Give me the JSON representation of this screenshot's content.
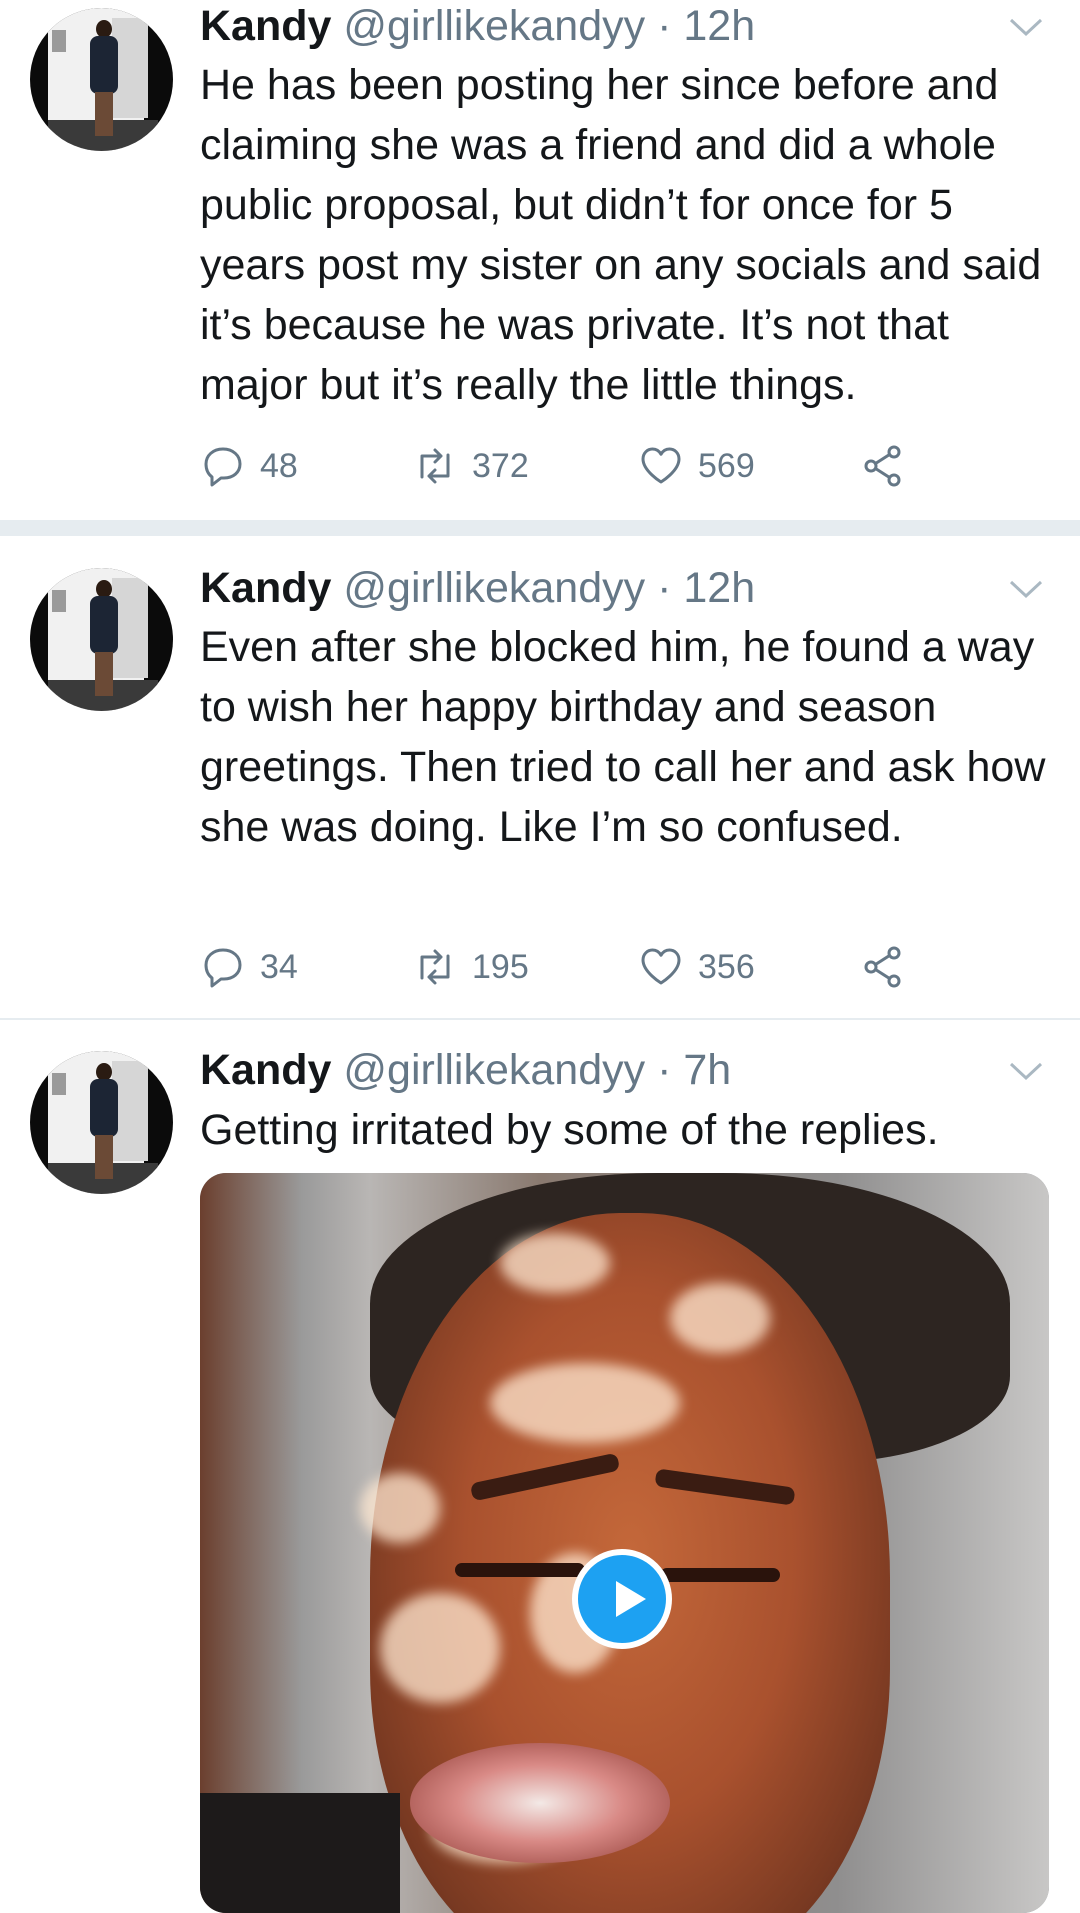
{
  "tweets": [
    {
      "name": "Kandy",
      "handle": "@girllikekandyy",
      "separator": "·",
      "time": "12h",
      "text": "He has been posting her since before and claiming she was a friend and did a whole public proposal, but didn’t for once for 5 years post my sister on any socials and said it’s because he was private. It’s not that major but it’s really the little things.",
      "replies": "48",
      "retweets": "372",
      "likes": "569"
    },
    {
      "name": "Kandy",
      "handle": "@girllikekandyy",
      "separator": "·",
      "time": "12h",
      "text": "Even after she blocked him, he found a way to wish her happy birthday and season greetings. Then tried to call her and ask how she was doing. Like I’m so confused.",
      "replies": "34",
      "retweets": "195",
      "likes": "356"
    },
    {
      "name": "Kandy",
      "handle": "@girllikekandyy",
      "separator": "·",
      "time": "7h",
      "text": "Getting irritated by some of the replies."
    }
  ],
  "icons": {
    "reply": "reply-icon",
    "retweet": "retweet-icon",
    "like": "heart-icon",
    "share": "share-icon",
    "menu": "chevron-down-icon",
    "play": "play-icon"
  },
  "colors": {
    "accent": "#1da1f2",
    "muted": "#657786",
    "divider": "#e6ecf0"
  }
}
